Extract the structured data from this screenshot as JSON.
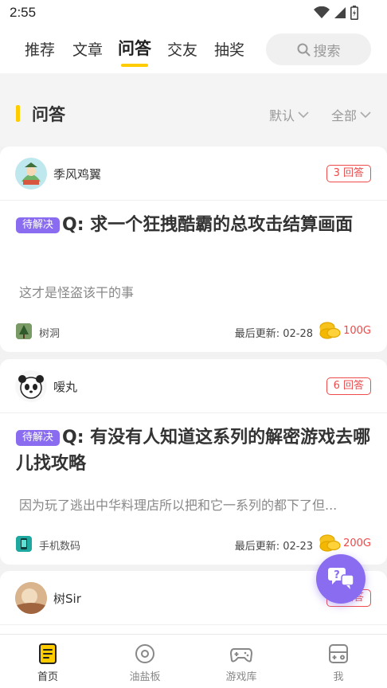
{
  "status_bar": {
    "time": "2:55"
  },
  "top_nav": {
    "tabs": [
      {
        "label": "推荐"
      },
      {
        "label": "文章"
      },
      {
        "label": "问答"
      },
      {
        "label": "交友"
      },
      {
        "label": "抽奖"
      }
    ],
    "active_tab": "问答",
    "search_placeholder": "搜索"
  },
  "section": {
    "title": "问答",
    "sort_filter": "默认",
    "range_filter": "全部"
  },
  "questions": [
    {
      "author": "季风鸡翼",
      "answers": "3 回答",
      "status": "待解决",
      "title": "Q: 求一个狂拽酷霸的总攻击结算画面",
      "description": "这才是怪盗该干的事",
      "board": "树洞",
      "last_update": "最后更新: 02-28",
      "reward": "100G"
    },
    {
      "author": "嗳丸",
      "answers": "6 回答",
      "status": "待解决",
      "title": "Q: 有没有人知道这系列的解密游戏去哪儿找攻略",
      "description": "因为玩了逃出中华料理店所以把和它一系列的都下了但...",
      "board": "手机数码",
      "last_update": "最后更新: 02-23",
      "reward": "200G"
    },
    {
      "author": "树Sir",
      "answers": "1 回答"
    }
  ],
  "bottom_nav": [
    {
      "label": "首页"
    },
    {
      "label": "油盐板"
    },
    {
      "label": "游戏库"
    },
    {
      "label": "我"
    }
  ],
  "colors": {
    "accent_yellow": "#ffcc00",
    "tag_purple": "#8a6cf0",
    "badge_red": "#ef4b4b"
  }
}
